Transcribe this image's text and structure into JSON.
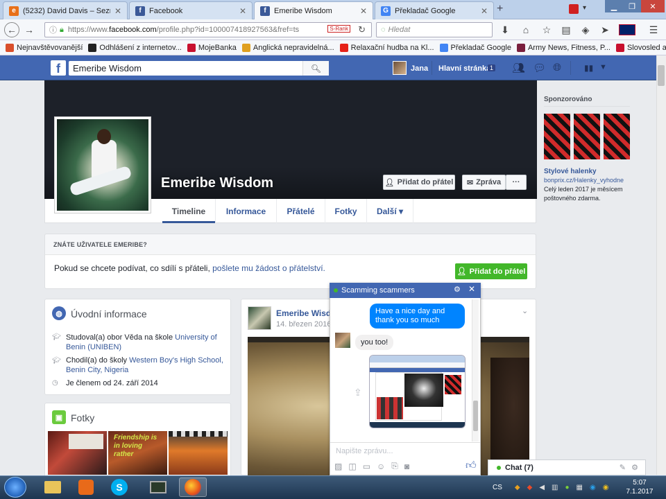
{
  "browser": {
    "tabs": [
      {
        "title": "(5232) David Davis – Sezna...",
        "active": false
      },
      {
        "title": "Facebook",
        "active": false
      },
      {
        "title": "Emeribe Wisdom",
        "active": true
      },
      {
        "title": "Překladač Google",
        "active": false
      }
    ],
    "url_prefix": "https://www.",
    "url_domain": "facebook.com",
    "url_rest": "/profile.php?id=100007418927563&fref=ts",
    "srank": "S-Rank",
    "search_placeholder": "Hledat",
    "bookmarks": [
      {
        "label": "Nejnavštěvovanější",
        "color": "#d94f2b"
      },
      {
        "label": "Odhlášení z internetov...",
        "color": "#222222"
      },
      {
        "label": "MojeBanka",
        "color": "#c8102e"
      },
      {
        "label": "Anglická nepravidelná...",
        "color": "#e0a020"
      },
      {
        "label": "Relaxační hudba na Kl...",
        "color": "#e62117"
      },
      {
        "label": "Překladač Google",
        "color": "#4285f4"
      },
      {
        "label": "Army News, Fitness, P...",
        "color": "#7a1f3d"
      },
      {
        "label": "Slovosled anglické vět...",
        "color": "#c8102e"
      }
    ]
  },
  "fb": {
    "search_value": "Emeribe Wisdom",
    "user_name": "Jana",
    "home_label": "Hlavní stránka",
    "home_count": "1"
  },
  "profile": {
    "name": "Emeribe Wisdom",
    "add_friend": "Přidat do přátel",
    "message": "Zpráva",
    "more": "···",
    "nav": [
      "Timeline",
      "Informace",
      "Přátelé",
      "Fotky",
      "Další ▾"
    ]
  },
  "know": {
    "header": "ZNÁTE UŽIVATELE EMERIBE?",
    "text": "Pokud se chcete podívat, co sdílí s přáteli, ",
    "link": "pošlete mu žádost o přátelství.",
    "button": "Přidat do přátel"
  },
  "intro": {
    "title": "Úvodní informace",
    "studied_prefix": "Studoval(a) obor Věda na škole ",
    "studied_link": "University of Benin (UNIBEN)",
    "went_prefix": "Chodil(a) do školy ",
    "went_link": "Western Boy's High School, Benin City, Nigeria",
    "member": "Je členem od 24. září 2014"
  },
  "photos": {
    "title": "Fotky",
    "photo2_caption": "Friendship is in loving rather"
  },
  "post": {
    "author": "Emeribe Wisd",
    "date": "14. březen 2016 ·"
  },
  "chat": {
    "title": "Scamming scammers",
    "msg_me": "Have a nice day and thank you so much",
    "msg_them": "you too!",
    "input_placeholder": "Napište zprávu..."
  },
  "sponsored": {
    "title": "Sponzorováno",
    "ad_title": "Stylové halenky",
    "ad_url": "bonprix.cz/Halenky_vyhodne",
    "ad_desc": "Celý leden 2017 je měsícem poštovného zdarma."
  },
  "chatbar": {
    "label": "Chat (7)"
  },
  "taskbar": {
    "lang": "CS",
    "time": "5:07",
    "date": "7.1.2017"
  }
}
